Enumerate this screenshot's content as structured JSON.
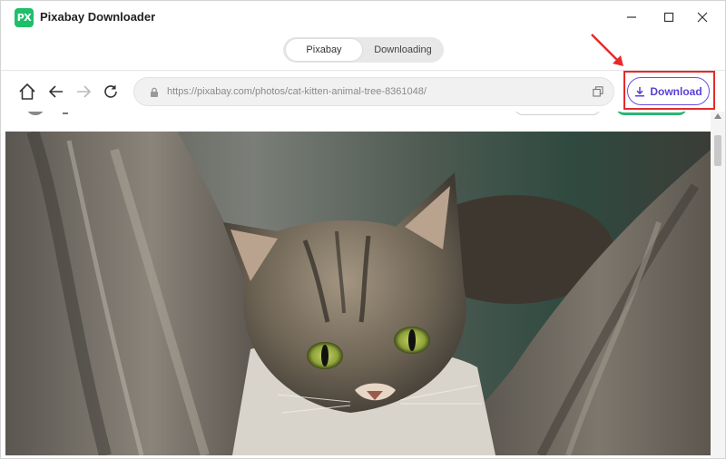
{
  "app": {
    "logo_text": "PX",
    "title": "Pixabay Downloader"
  },
  "tabs": [
    {
      "label": "Pixabay",
      "active": true
    },
    {
      "label": "Downloading",
      "active": false
    }
  ],
  "browser": {
    "url": "https://pixabay.com/photos/cat-kitten-animal-tree-8361048/"
  },
  "download_button": {
    "label": "Download",
    "icon": "download-icon"
  },
  "colors": {
    "logo_green": "#1fbf6a",
    "download_purple": "#5a3fd6",
    "highlight_red": "#e52a2a"
  }
}
